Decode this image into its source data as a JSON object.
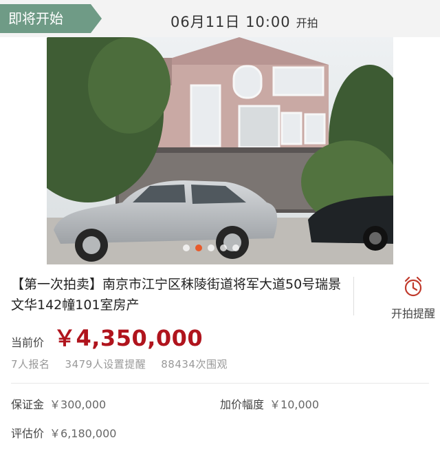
{
  "banner": {
    "status": "即将开始",
    "start_time": "06月11日  10:00",
    "start_suffix": "开拍"
  },
  "gallery": {
    "image_description_icon": "house-photo",
    "dot_count": 5,
    "active_index": 1
  },
  "listing": {
    "title": "【第一次拍卖】南京市江宁区秣陵街道将军大道50号瑞景文华142幢101室房产"
  },
  "reminder": {
    "icon": "alarm-clock-icon",
    "label": "开拍提醒"
  },
  "price": {
    "label": "当前价",
    "value": "￥4,350,000"
  },
  "stats": {
    "signups": "7人报名",
    "reminders": "3479人设置提醒",
    "views": "88434次围观"
  },
  "details": {
    "deposit_label": "保证金",
    "deposit_value": "￥300,000",
    "increment_label": "加价幅度",
    "increment_value": "￥10,000",
    "appraisal_label": "评估价",
    "appraisal_value": "￥6,180,000"
  },
  "colors": {
    "status_bg": "#6f9b86",
    "price": "#b0141d",
    "active_dot": "#e85a2a",
    "reminder_icon": "#c0392b"
  }
}
